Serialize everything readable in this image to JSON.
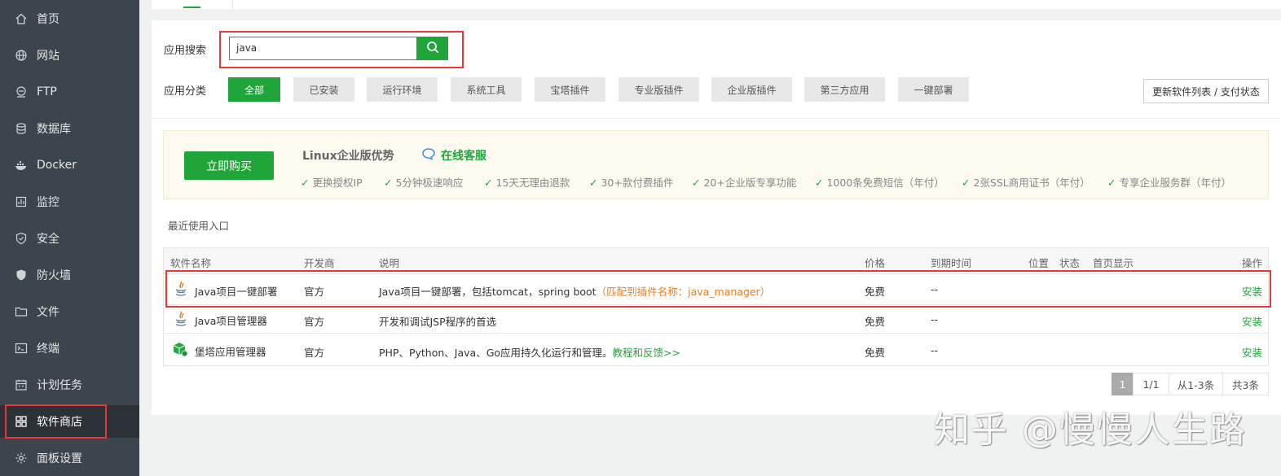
{
  "sidebar": {
    "items": [
      {
        "label": "首页",
        "icon": "home-icon"
      },
      {
        "label": "网站",
        "icon": "globe-icon"
      },
      {
        "label": "FTP",
        "icon": "ftp-icon"
      },
      {
        "label": "数据库",
        "icon": "database-icon"
      },
      {
        "label": "Docker",
        "icon": "docker-icon"
      },
      {
        "label": "监控",
        "icon": "monitor-icon"
      },
      {
        "label": "安全",
        "icon": "shield-icon"
      },
      {
        "label": "防火墙",
        "icon": "firewall-icon"
      },
      {
        "label": "文件",
        "icon": "folder-icon"
      },
      {
        "label": "终端",
        "icon": "terminal-icon"
      },
      {
        "label": "计划任务",
        "icon": "calendar-icon"
      },
      {
        "label": "软件商店",
        "icon": "grid-icon",
        "active": true
      },
      {
        "label": "面板设置",
        "icon": "gear-icon"
      }
    ]
  },
  "search": {
    "label": "应用搜索",
    "value": "java"
  },
  "categories": {
    "label": "应用分类",
    "items": [
      "全部",
      "已安装",
      "运行环境",
      "系统工具",
      "宝塔插件",
      "专业版插件",
      "企业版插件",
      "第三方应用",
      "一键部署"
    ],
    "active": "全部"
  },
  "update_button": "更新软件列表 / 支付状态",
  "promo": {
    "buy_label": "立即购买",
    "title": "Linux企业版优势",
    "service_label": "在线客服",
    "features": [
      "更换授权IP",
      "5分钟极速响应",
      "15天无理由退款",
      "30+款付费插件",
      "20+企业版专享功能",
      "1000条免费短信（年付）",
      "2张SSL商用证书（年付）",
      "专享企业服务群（年付）"
    ]
  },
  "recent_label": "最近使用入口",
  "table": {
    "headers": [
      "软件名称",
      "开发商",
      "说明",
      "价格",
      "到期时间",
      "位置",
      "状态",
      "首页显示",
      "操作"
    ],
    "rows": [
      {
        "icon": "java-icon",
        "name": "Java项目一键部署",
        "developer": "官方",
        "desc": "Java项目一键部署，包括tomcat，spring boot",
        "desc_extra": "（匹配到插件名称：java_manager）",
        "price": "免费",
        "expire": "--",
        "action": "安装"
      },
      {
        "icon": "java-icon",
        "name": "Java项目管理器",
        "developer": "官方",
        "desc": "开发和调试JSP程序的首选",
        "desc_extra": "",
        "price": "免费",
        "expire": "--",
        "action": "安装"
      },
      {
        "icon": "package-icon",
        "name": "堡塔应用管理器",
        "developer": "官方",
        "desc": "PHP、Python、Java、Go应用持久化运行和管理。",
        "desc_extra": "教程和反馈>>",
        "price": "免费",
        "expire": "--",
        "action": "安装"
      }
    ]
  },
  "pagination": {
    "current": "1",
    "pages": "1/1",
    "range": "从1-3条",
    "total": "共3条"
  },
  "watermark": "知乎 @慢慢人生路",
  "colors": {
    "accent": "#20a53a",
    "sidebar": "#3c444d",
    "highlight": "#e03a3a",
    "match": "#e67e22"
  }
}
